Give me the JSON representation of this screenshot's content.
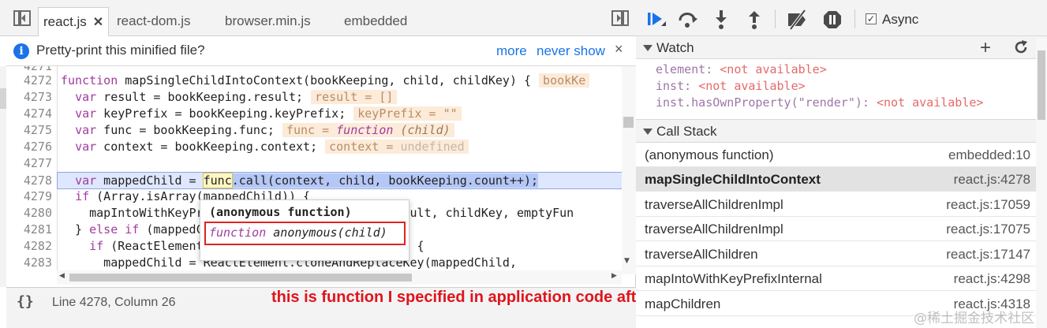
{
  "editor": {
    "tabs": [
      {
        "label": "react.js",
        "active": true
      },
      {
        "label": "react-dom.js"
      },
      {
        "label": "browser.min.js"
      },
      {
        "label": "embedded"
      }
    ],
    "infobar": {
      "icon": "info-icon",
      "icon_glyph": "i",
      "message": "Pretty-print this minified file?",
      "more": "more",
      "never_show": "never show",
      "close": "×"
    },
    "code": {
      "line_numbers": [
        "4271",
        "4272",
        "4273",
        "4274",
        "4275",
        "4276",
        "4277",
        "4278",
        "4279",
        "4280",
        "4281",
        "4282",
        "4283",
        "4284"
      ],
      "lines": {
        "l4272": {
          "kw": "function",
          "text": " mapSingleChildIntoContext(bookKeeping, child, childKey) {",
          "inline": "bookKe"
        },
        "l4273": {
          "indent": "  ",
          "kw": "var",
          "text": " result = bookKeeping.result;",
          "inline": "result = []"
        },
        "l4274": {
          "indent": "  ",
          "kw": "var",
          "text": " keyPrefix = bookKeeping.keyPrefix;",
          "inline": "keyPrefix = \"\""
        },
        "l4275": {
          "indent": "  ",
          "kw": "var",
          "text": " func = bookKeeping.func;",
          "inline_pre": "func = ",
          "inline_kw": "function",
          "inline_post": " (child)"
        },
        "l4276": {
          "indent": "  ",
          "kw": "var",
          "text": " context = bookKeeping.context;",
          "inline_pre": "context = ",
          "inline_post": "undefined"
        },
        "l4278": {
          "indent": "  ",
          "kw": "var",
          "text_a": " mappedChild = ",
          "token": "func",
          "selected": ".call(context, child, bookKeeping.count++);"
        },
        "l4279": {
          "indent": "  ",
          "kw": "if",
          "text": " (Array.isArray(mappedChild)) {"
        },
        "l4280": {
          "text": "    mapIntoWithKeyPrefixInternal(mappedChild, result, childKey, emptyFun"
        },
        "l4281": {
          "text_a": "  } ",
          "kw": "else if",
          "text": " (mappedChild != null) {"
        },
        "l4282": {
          "indent": "    ",
          "kw": "if",
          "text": " (ReactElement.isValidElement(mappedChild)) {"
        },
        "l4283": {
          "text": "      mappedChild = ReactElement.cloneAndReplaceKey(mappedChild,"
        }
      }
    },
    "popover": {
      "title": "(anonymous function)",
      "fn_kw": "function",
      "fn_rest": " anonymous(child)"
    },
    "status": {
      "braces": "{}",
      "cursor": "Line 4278, Column 26"
    }
  },
  "annotation": "this is function I specified in application code after .map",
  "debugger": {
    "toolbar": {
      "icons": [
        "resume-icon",
        "step-over-icon",
        "step-into-icon",
        "step-out-icon",
        "deactivate-breakpoints-icon",
        "pause-on-exceptions-icon"
      ],
      "async_label": "Async",
      "async_checked": true
    },
    "watch": {
      "title": "Watch",
      "items": [
        {
          "name": "element",
          "value": "<not available>"
        },
        {
          "name": "inst",
          "value": "<not available>"
        },
        {
          "name": "inst.hasOwnProperty(\"render\")",
          "value": "<not available>"
        }
      ]
    },
    "call_stack": {
      "title": "Call Stack",
      "frames": [
        {
          "fn": "(anonymous function)",
          "loc": "embedded:10"
        },
        {
          "fn": "mapSingleChildIntoContext",
          "loc": "react.js:4278",
          "selected": true
        },
        {
          "fn": "traverseAllChildrenImpl",
          "loc": "react.js:17059"
        },
        {
          "fn": "traverseAllChildrenImpl",
          "loc": "react.js:17075"
        },
        {
          "fn": "traverseAllChildren",
          "loc": "react.js:17147"
        },
        {
          "fn": "mapIntoWithKeyPrefixInternal",
          "loc": "react.js:4298"
        },
        {
          "fn": "mapChildren",
          "loc": "react.js:4318"
        }
      ]
    }
  },
  "watermark": "@稀土掘金技术社区",
  "colors": {
    "keyword": "#a03c9f",
    "link": "#1a73e8",
    "annotation": "#e0141c",
    "inline_value_bg": "#fcebd9",
    "exec_line_bg": "#dee7fd"
  }
}
